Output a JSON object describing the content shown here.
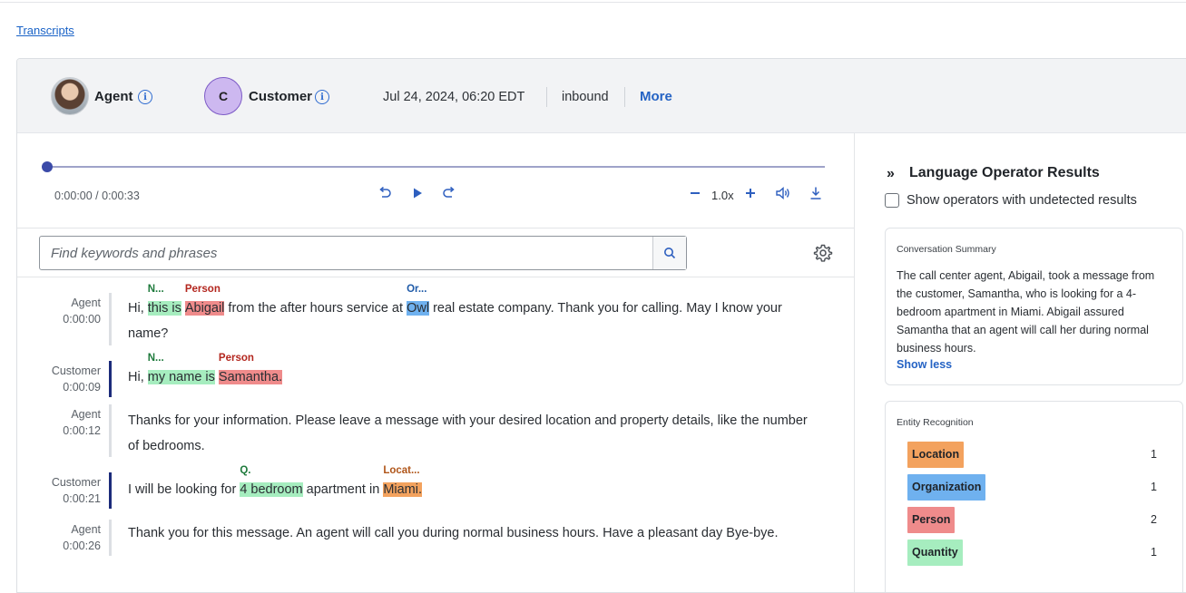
{
  "breadcrumb": "Transcripts",
  "header": {
    "agent_label": "Agent",
    "customer_initial": "C",
    "customer_label": "Customer",
    "datetime": "Jul 24, 2024, 06:20 EDT",
    "direction": "inbound",
    "more": "More"
  },
  "player": {
    "time": "0:00:00 / 0:00:33",
    "speed": "1.0x",
    "progress": 0
  },
  "search": {
    "placeholder": "Find keywords and phrases"
  },
  "transcript": [
    {
      "speaker": "Agent",
      "time": "0:00:00",
      "parts": [
        {
          "t": "Hi, "
        },
        {
          "t": "this is",
          "c": "g",
          "tag": "N..."
        },
        {
          "t": " "
        },
        {
          "t": "Abigail",
          "c": "r",
          "tag": "Person"
        },
        {
          "t": " from the after hours service at "
        },
        {
          "t": "Owl",
          "c": "b",
          "tag": "Or..."
        },
        {
          "t": " real estate company. Thank you for calling. May I know your name?"
        }
      ]
    },
    {
      "speaker": "Customer",
      "time": "0:00:09",
      "parts": [
        {
          "t": "Hi, "
        },
        {
          "t": "my name is",
          "c": "g",
          "tag": "N..."
        },
        {
          "t": " "
        },
        {
          "t": "Samantha.",
          "c": "r",
          "tag": "Person"
        }
      ]
    },
    {
      "speaker": "Agent",
      "time": "0:00:12",
      "parts": [
        {
          "t": "Thanks for your information. Please leave a message with your desired location and property details, like the number of bedrooms."
        }
      ]
    },
    {
      "speaker": "Customer",
      "time": "0:00:21",
      "parts": [
        {
          "t": "I will be looking for "
        },
        {
          "t": "4 bedroom",
          "c": "g",
          "tag": "Q."
        },
        {
          "t": " apartment in "
        },
        {
          "t": "Miami.",
          "c": "o",
          "tag": "Locat..."
        }
      ]
    },
    {
      "speaker": "Agent",
      "time": "0:00:26",
      "parts": [
        {
          "t": "Thank you for this message. An agent will call you during normal business hours. Have a pleasant day Bye-bye."
        }
      ]
    }
  ],
  "operators": {
    "title": "Language Operator Results",
    "show_undetected": "Show operators with undetected results",
    "summary": {
      "title": "Conversation Summary",
      "text": "The call center agent, Abigail, took a message from the customer, Samantha, who is looking for a 4-bedroom apartment in Miami. Abigail assured Samantha that an agent will call her during normal business hours.",
      "show_less": "Show less"
    },
    "entities": {
      "title": "Entity Recognition",
      "items": [
        {
          "label": "Location",
          "count": "1",
          "color": "#f3a25e"
        },
        {
          "label": "Organization",
          "count": "1",
          "color": "#6fb1ef"
        },
        {
          "label": "Person",
          "count": "2",
          "color": "#ef8b8b"
        },
        {
          "label": "Quantity",
          "count": "1",
          "color": "#a6edbf"
        }
      ]
    }
  }
}
